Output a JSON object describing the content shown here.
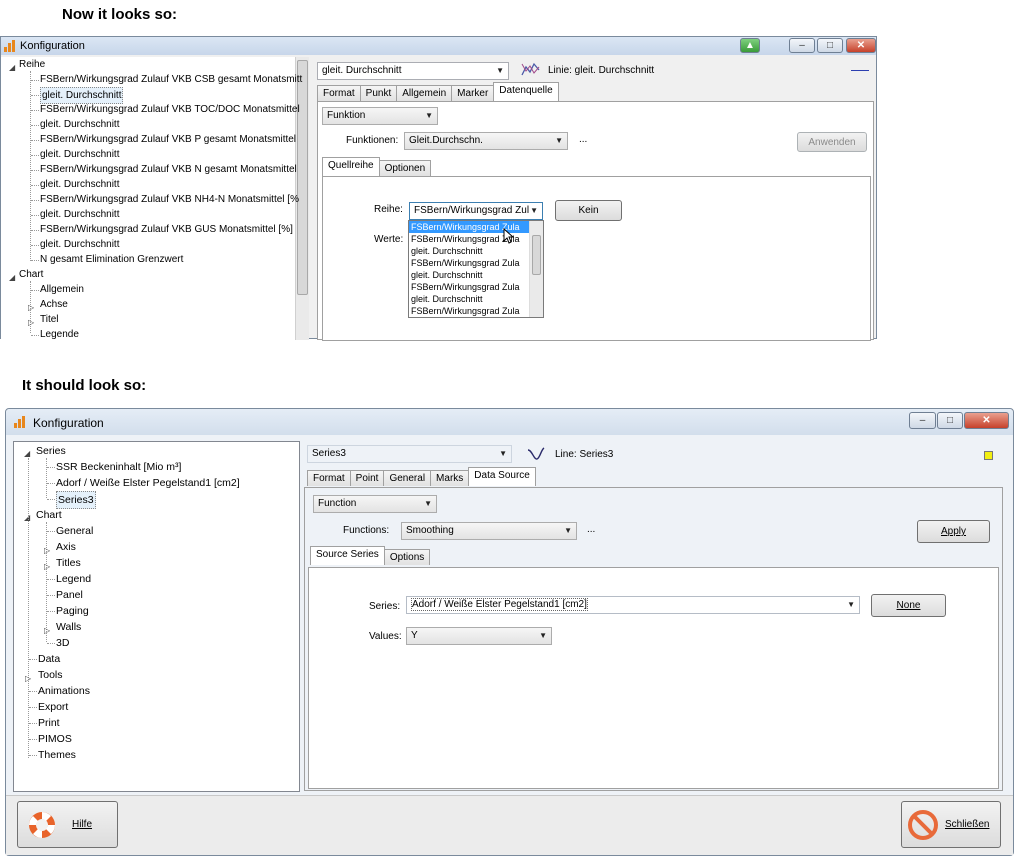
{
  "headings": {
    "before": "Now it looks so:",
    "after": "It should look so:"
  },
  "top_window": {
    "title": "Konfiguration",
    "tree": {
      "root_series": "Reihe",
      "series_items": [
        "FSBern/Wirkungsgrad Zulauf VKB CSB gesamt Monatsmitt",
        "gleit. Durchschnitt",
        "FSBern/Wirkungsgrad Zulauf VKB TOC/DOC Monatsmittel",
        "gleit. Durchschnitt",
        "FSBern/Wirkungsgrad Zulauf VKB P gesamt Monatsmittel",
        "gleit. Durchschnitt",
        "FSBern/Wirkungsgrad Zulauf VKB N gesamt Monatsmittel",
        "gleit. Durchschnitt",
        "FSBern/Wirkungsgrad Zulauf VKB NH4-N Monatsmittel [%",
        "gleit. Durchschnitt",
        "FSBern/Wirkungsgrad Zulauf VKB GUS Monatsmittel [%]",
        "gleit. Durchschnitt",
        "N gesamt Elimination Grenzwert"
      ],
      "root_chart": "Chart",
      "chart_items": [
        "Allgemein",
        "Achse",
        "Titel",
        "Legende"
      ]
    },
    "series_combo": "gleit. Durchschnitt",
    "series_caption": "Linie: gleit. Durchschnitt",
    "tabs": [
      "Format",
      "Punkt",
      "Allgemein",
      "Marker",
      "Datenquelle"
    ],
    "function_combo": "Funktion",
    "functions_label": "Funktionen:",
    "functions_value": "Gleit.Durchschn.",
    "ellipsis": "...",
    "apply_button": "Anwenden",
    "subtabs": [
      "Quellreihe",
      "Optionen"
    ],
    "series_label": "Reihe:",
    "series_value": "FSBern/Wirkungsgrad Zul",
    "none_button": "Kein",
    "values_label": "Werte:",
    "dropdown_items": [
      "FSBern/Wirkungsgrad Zula",
      "FSBern/Wirkungsgrad Zula",
      "gleit. Durchschnitt",
      "FSBern/Wirkungsgrad Zula",
      "gleit. Durchschnitt",
      "FSBern/Wirkungsgrad Zula",
      "gleit. Durchschnitt",
      "FSBern/Wirkungsgrad Zula"
    ]
  },
  "bottom_window": {
    "title": "Konfiguration",
    "tree": {
      "root_series": "Series",
      "series_items": [
        "SSR Beckeninhalt  [Mio m³]",
        "Adorf / Weiße Elster Pegelstand1  [cm2]",
        "Series3"
      ],
      "root_chart": "Chart",
      "chart_items": [
        "General",
        "Axis",
        "Titles",
        "Legend",
        "Panel",
        "Paging",
        "Walls",
        "3D"
      ],
      "other_items": [
        "Data",
        "Tools",
        "Animations",
        "Export",
        "Print",
        "PIMOS",
        "Themes"
      ]
    },
    "series_combo": "Series3",
    "series_caption": "Line: Series3",
    "tabs": [
      "Format",
      "Point",
      "General",
      "Marks",
      "Data Source"
    ],
    "function_combo": "Function",
    "functions_label": "Functions:",
    "functions_value": "Smoothing",
    "ellipsis": "...",
    "apply_button": "Apply",
    "subtabs": [
      "Source Series",
      "Options"
    ],
    "series_label": "Series:",
    "series_value": "Adorf / Weiße Elster Pegelstand1  [cm2]",
    "none_button": "None",
    "values_label": "Values:",
    "values_value": "Y",
    "help_button": "Hilfe",
    "close_button": "Schließen"
  }
}
